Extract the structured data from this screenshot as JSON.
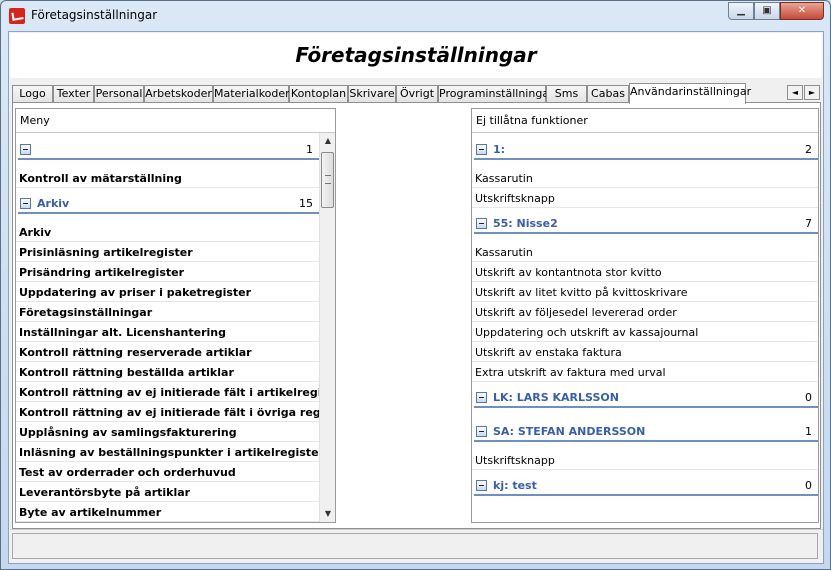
{
  "window": {
    "title": "Företagsinställningar",
    "controls": {
      "minimize": "▁",
      "maximize": "▣",
      "close": "✕"
    }
  },
  "header": {
    "title": "Företagsinställningar"
  },
  "tabs": [
    {
      "label": "Logo"
    },
    {
      "label": "Texter"
    },
    {
      "label": "Personal"
    },
    {
      "label": "Arbetskoder"
    },
    {
      "label": "Materialkoder"
    },
    {
      "label": "Kontoplan"
    },
    {
      "label": "Skrivare"
    },
    {
      "label": "Övrigt"
    },
    {
      "label": "Programinställningar"
    },
    {
      "label": "Sms"
    },
    {
      "label": "Cabas"
    },
    {
      "label": "Användarinställningar"
    }
  ],
  "tab_scroll": {
    "left": "◄",
    "right": "►"
  },
  "left_panel": {
    "header": "Meny",
    "groups": [
      {
        "name": "",
        "count": "1",
        "items": [
          "Kontroll av mätarställning"
        ]
      },
      {
        "name": "Arkiv",
        "count": "15",
        "items": [
          "Arkiv",
          "Prisinläsning artikelregister",
          "Prisändring artikelregister",
          "Uppdatering av priser i paketregister",
          "Företagsinställningar",
          "Inställningar alt. Licenshantering",
          "Kontroll rättning reserverade artiklar",
          "Kontroll rättning beställda artiklar",
          "Kontroll rättning av ej initierade fält i artikelregister",
          "Kontroll rättning av ej initierade fält i övriga register",
          "Upplåsning av samlingsfakturering",
          "Inläsning av beställningspunkter i artikelregister",
          "Test av orderrader och orderhuvud",
          "Leverantörsbyte på artiklar",
          "Byte av artikelnummer"
        ]
      }
    ],
    "scroll": {
      "up": "▲",
      "down": "▼"
    }
  },
  "right_panel": {
    "header": "Ej tillåtna funktioner",
    "groups": [
      {
        "name": "1:",
        "count": "2",
        "items": [
          "Kassarutin",
          "Utskriftsknapp"
        ]
      },
      {
        "name": "55: Nisse2",
        "count": "7",
        "items": [
          "Kassarutin",
          "Utskrift av kontantnota stor kvitto",
          "Utskrift av litet kvitto på kvittoskrivare",
          "Utskrift av följesedel levererad order",
          "Uppdatering och utskrift av kassajournal",
          "Utskrift av enstaka faktura",
          "Extra utskrift av faktura med urval"
        ]
      },
      {
        "name": "LK: LARS KARLSSON",
        "count": "0",
        "items": []
      },
      {
        "name": "SA: STEFAN ANDERSSON",
        "count": "1",
        "items": [
          "Utskriftsknapp"
        ]
      },
      {
        "name": "kj: test",
        "count": "0",
        "items": []
      }
    ]
  },
  "statusbar": {
    "text": ""
  }
}
